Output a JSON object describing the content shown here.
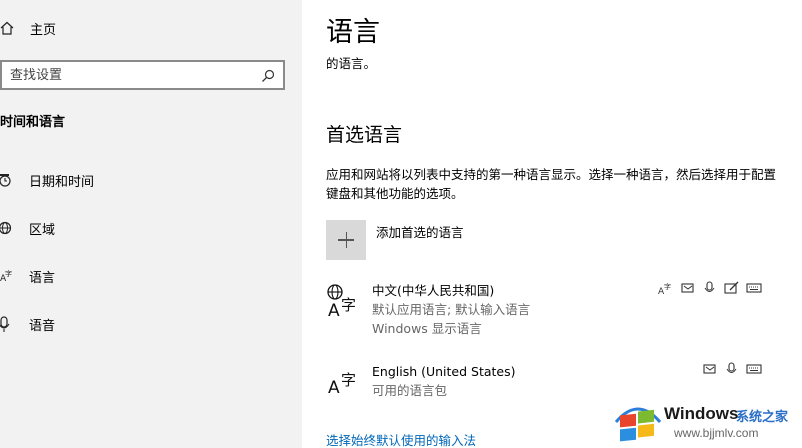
{
  "sidebar": {
    "home_label": "主页",
    "search_placeholder": "查找设置",
    "section_title": "时间和语言",
    "items": [
      {
        "label": "日期和时间",
        "icon": "clock-icon"
      },
      {
        "label": "区域",
        "icon": "globe-icon"
      },
      {
        "label": "语言",
        "icon": "language-icon"
      },
      {
        "label": "语音",
        "icon": "microphone-icon"
      }
    ]
  },
  "main": {
    "title": "语言",
    "sub_text": "的语言。",
    "preferred_heading": "首选语言",
    "description": "应用和网站将以列表中支持的第一种语言显示。选择一种语言，然后选择用于配置键盘和其他功能的选项。",
    "add_label": "添加首选的语言",
    "languages": [
      {
        "name": "中文(中华人民共和国)",
        "meta1": "默认应用语言; 默认输入语言",
        "meta2": "Windows 显示语言",
        "features": [
          "language-pack-icon",
          "text-to-speech-icon",
          "speech-icon",
          "handwriting-icon",
          "keyboard-icon"
        ]
      },
      {
        "name": "English (United States)",
        "meta1": "可用的语言包",
        "features": [
          "text-to-speech-icon",
          "speech-icon",
          "keyboard-icon"
        ]
      }
    ],
    "input_method_link": "选择始终默认使用的输入法"
  },
  "watermark": {
    "brand": "Windows",
    "cn": "系统之家",
    "url": "www.bjjmlv.com"
  },
  "colors": {
    "sidebar_bg": "#f2f2f2",
    "link": "#0067b8",
    "add_box": "#d9d9d9"
  }
}
